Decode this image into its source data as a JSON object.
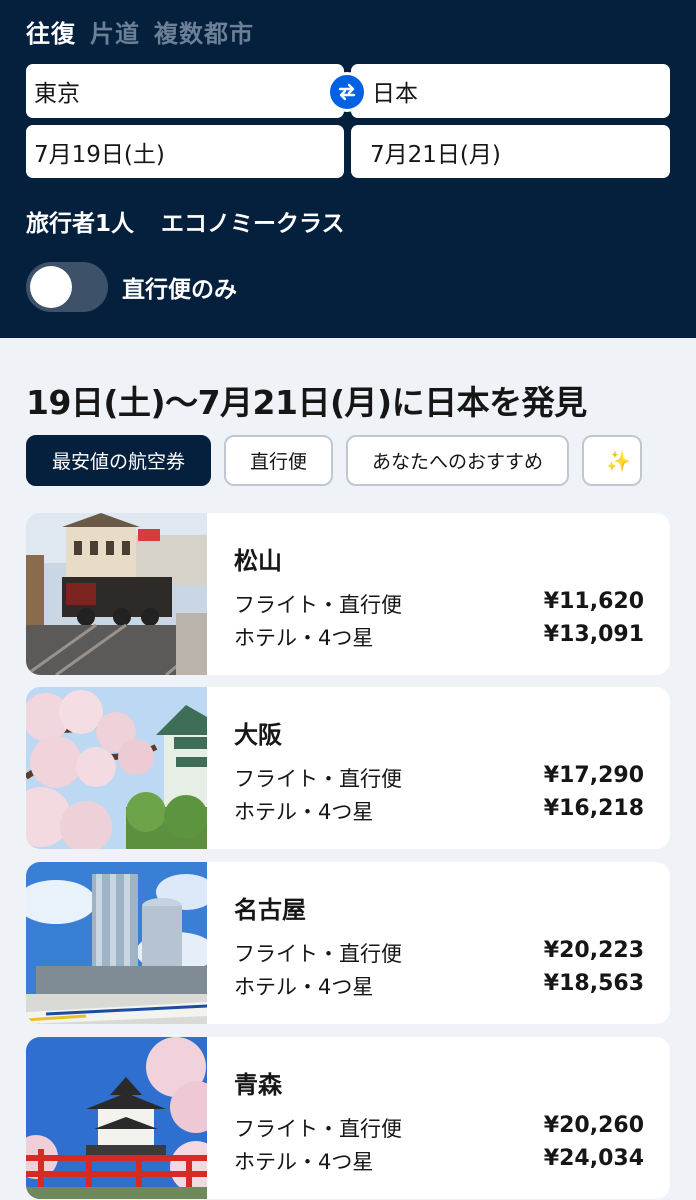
{
  "trip_types": [
    "往復",
    "片道",
    "複数都市"
  ],
  "search": {
    "origin": "東京",
    "destination": "日本",
    "depart_date": "7月19日(土)",
    "return_date": "7月21日(月)",
    "travellers": "旅行者1人",
    "cabin_class": "エコノミークラス",
    "direct_only_label": "直行便のみ",
    "direct_only": false
  },
  "section_title": "19日(土)〜7月21日(月)に日本を発見",
  "filter_chips": [
    "最安値の航空券",
    "直行便",
    "あなたへのおすすめ"
  ],
  "extra_chip_icon": "sparkle-icon",
  "destinations": [
    {
      "city": "松山",
      "flight_label": "フライト・直行便",
      "flight_price": "¥11,620",
      "hotel_label": "ホテル・4つ星",
      "hotel_price": "¥13,091"
    },
    {
      "city": "大阪",
      "flight_label": "フライト・直行便",
      "flight_price": "¥17,290",
      "hotel_label": "ホテル・4つ星",
      "hotel_price": "¥16,218"
    },
    {
      "city": "名古屋",
      "flight_label": "フライト・直行便",
      "flight_price": "¥20,223",
      "hotel_label": "ホテル・4つ星",
      "hotel_price": "¥18,563"
    },
    {
      "city": "青森",
      "flight_label": "フライト・直行便",
      "flight_price": "¥20,260",
      "hotel_label": "ホテル・4つ星",
      "hotel_price": "¥24,034"
    }
  ],
  "colors": {
    "header_bg": "#05203c",
    "accent_blue": "#0062e3",
    "page_bg": "#eff2f7"
  }
}
